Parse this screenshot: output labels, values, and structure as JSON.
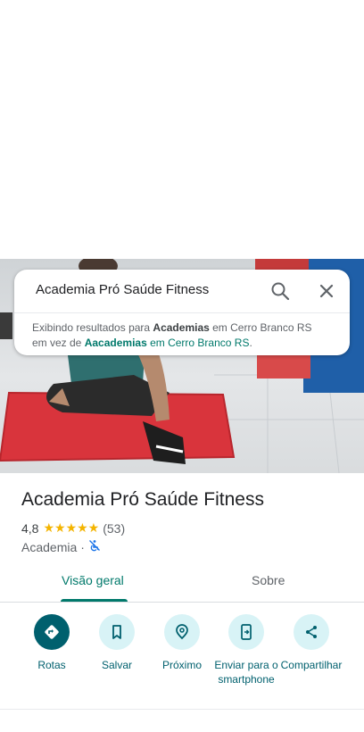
{
  "search": {
    "query": "Academia Pró Saúde Fitness",
    "notice_prefix": "Exibindo resultados para ",
    "notice_term": "Academias",
    "notice_location": " em Cerro Branco RS",
    "notice_line2_prefix": "em vez de ",
    "notice_alt_term": "Aacademias",
    "notice_alt_location": " em Cerro Branco RS",
    "notice_end": "."
  },
  "place": {
    "title": "Academia Pró Saúde Fitness",
    "rating": "4,8",
    "stars": "★★★★★",
    "review_count": "(53)",
    "category": "Academia",
    "separator": "·"
  },
  "tabs": [
    {
      "label": "Visão geral",
      "active": true
    },
    {
      "label": "Sobre",
      "active": false
    }
  ],
  "actions": [
    {
      "label": "Rotas",
      "icon": "directions-icon"
    },
    {
      "label": "Salvar",
      "icon": "bookmark-icon"
    },
    {
      "label": "Próximo",
      "icon": "nearby-icon"
    },
    {
      "label": "Enviar para o smartphone",
      "icon": "send-to-phone-icon"
    },
    {
      "label": "Compartilhar",
      "icon": "share-icon"
    }
  ],
  "colors": {
    "accent": "#00796b",
    "action_primary": "#00606e",
    "action_bg": "#d8f3f6",
    "star": "#f4b400",
    "mat_red": "#d9343c"
  }
}
